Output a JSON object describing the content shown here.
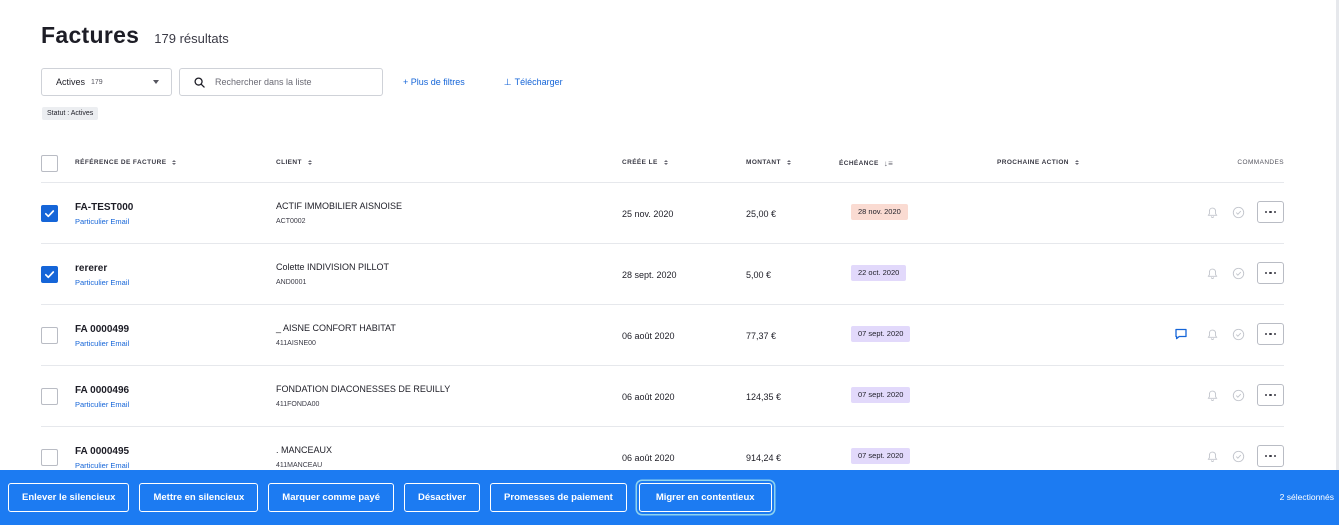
{
  "header": {
    "title": "Factures",
    "result_count": "179 résultats"
  },
  "toolbar": {
    "status_select": {
      "value": "Actives",
      "count": "179"
    },
    "search": {
      "placeholder": "Rechercher dans la liste",
      "value": ""
    },
    "more_filters": "+ Plus de filtres",
    "download": "Télécharger"
  },
  "active_filter_chip": "Statut : Actives",
  "table": {
    "columns": {
      "reference": "Référence de facture",
      "client": "Client",
      "created": "Créée le",
      "amount": "Montant",
      "due": "Échéance",
      "next_action": "Prochaine action",
      "commands": "Commandes"
    },
    "rows": [
      {
        "checked": true,
        "ref": "FA-TEST000",
        "ref_type": "Particulier Email",
        "client": "ACTIF IMMOBILIER AISNOISE",
        "client_code": "ACT0002",
        "created": "25 nov. 2020",
        "amount": "25,00 €",
        "due": "28 nov. 2020",
        "due_status": "late",
        "has_comment": false
      },
      {
        "checked": true,
        "ref": "rererer",
        "ref_type": "Particulier Email",
        "client": "Colette INDIVISION PILLOT",
        "client_code": "AND0001",
        "created": "28 sept. 2020",
        "amount": "5,00 €",
        "due": "22 oct. 2020",
        "due_status": "upcoming",
        "has_comment": false
      },
      {
        "checked": false,
        "ref": "FA 0000499",
        "ref_type": "Particulier Email",
        "client": "_ AISNE CONFORT HABITAT",
        "client_code": "411AISNE00",
        "created": "06 août 2020",
        "amount": "77,37 €",
        "due": "07 sept. 2020",
        "due_status": "upcoming",
        "has_comment": true
      },
      {
        "checked": false,
        "ref": "FA 0000496",
        "ref_type": "Particulier Email",
        "client": "FONDATION DIACONESSES DE REUILLY",
        "client_code": "411FONDA00",
        "created": "06 août 2020",
        "amount": "124,35 €",
        "due": "07 sept. 2020",
        "due_status": "upcoming",
        "has_comment": false
      },
      {
        "checked": false,
        "ref": "FA 0000495",
        "ref_type": "Particulier Email",
        "client": ". MANCEAUX",
        "client_code": "411MANCEAU",
        "created": "06 août 2020",
        "amount": "914,24 €",
        "due": "07 sept. 2020",
        "due_status": "upcoming",
        "has_comment": false
      }
    ]
  },
  "bulk_actions": {
    "unmute": "Enlever le silencieux",
    "mute": "Mettre en silencieux",
    "mark_paid": "Marquer comme payé",
    "deactivate": "Désactiver",
    "payment_promises": "Promesses de paiement",
    "migrate_litigation": "Migrer en contentieux",
    "selected_count": "2 sélectionnés"
  },
  "colors": {
    "accent": "#1565d8",
    "bottom_bar": "#1c7bf2",
    "due_late_bg": "#fadbd2",
    "due_upcoming_bg": "#e2d9fb"
  }
}
